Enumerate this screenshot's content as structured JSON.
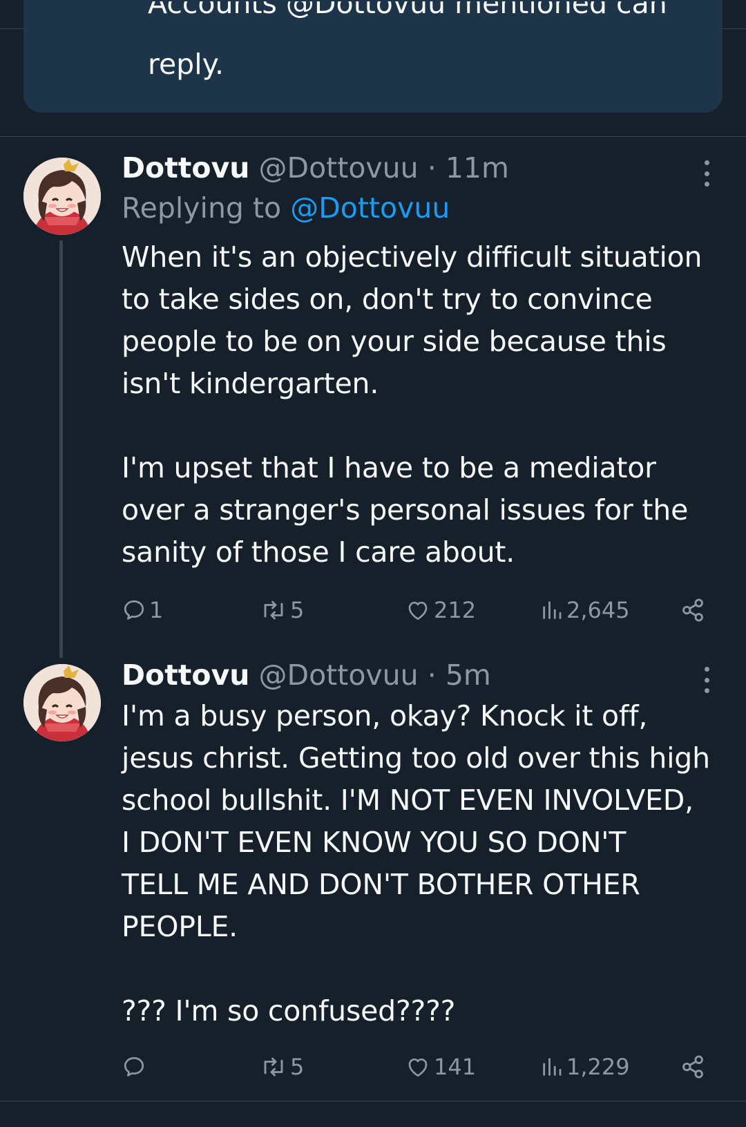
{
  "notice": {
    "text_partial": "Accounts @Dottovuu mentioned can",
    "text": "reply."
  },
  "tweets": [
    {
      "display_name": "Dottovu",
      "handle": "@Dottovuu",
      "separator": "·",
      "time": "11m",
      "replying_prefix": "Replying to",
      "replying_to": "@Dottovuu",
      "body": "When it's an objectively difficult situation\nto take sides on, don't try to convince\npeople to be on your side because this\nisn't kindergarten.\n\nI'm upset that I have to be a mediator\nover a stranger's personal issues for the\nsanity of those I care about.",
      "replies": "1",
      "reposts": "5",
      "likes": "212",
      "views": "2,645"
    },
    {
      "display_name": "Dottovu",
      "handle": "@Dottovuu",
      "separator": "·",
      "time": "5m",
      "body": "I'm a busy person, okay? Knock it off,\njesus christ. Getting too old over this high\nschool bullshit. I'M NOT EVEN INVOLVED,\nI DON'T EVEN KNOW YOU SO DON'T\nTELL ME AND DON'T BOTHER OTHER\nPEOPLE.\n\n??? I'm so confused????",
      "replies": "",
      "reposts": "5",
      "likes": "141",
      "views": "1,229"
    }
  ],
  "colors": {
    "background": "#15202b",
    "notice_bg": "#1e3448",
    "text": "#f7f9f9",
    "muted": "#8b98a5",
    "accent": "#1d9bf0",
    "divider": "#38444d"
  },
  "icons": [
    "more-icon",
    "reply-icon",
    "repost-icon",
    "like-icon",
    "views-icon",
    "share-icon"
  ]
}
